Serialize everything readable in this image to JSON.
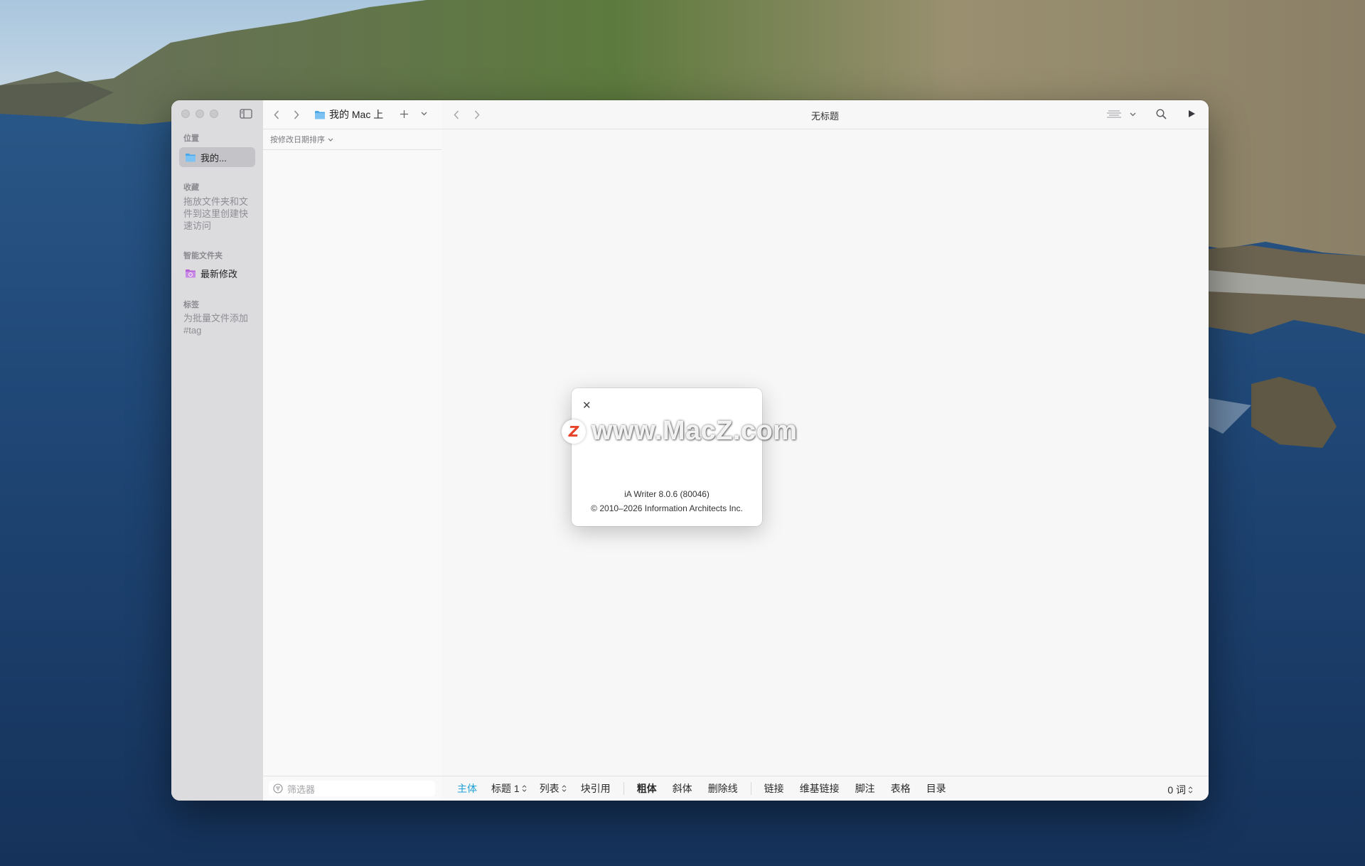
{
  "sidebar": {
    "locations_header": "位置",
    "location_item": "我的...",
    "favorites_header": "收藏",
    "favorites_hint": "拖放文件夹和文件到这里创建快速访问",
    "smart_header": "智能文件夹",
    "smart_item": "最新修改",
    "tags_header": "标签",
    "tags_hint": "为批量文件添加#tag"
  },
  "filelist": {
    "path_label": "我的 Mac 上",
    "sort_label": "按修改日期排序",
    "filter_placeholder": "筛选器"
  },
  "editor": {
    "title": "无标题"
  },
  "format_bar": {
    "body": "主体",
    "heading": "标题 1",
    "list": "列表",
    "blockquote": "块引用",
    "bold": "粗体",
    "italic": "斜体",
    "strikethrough": "删除线",
    "link": "链接",
    "wikilink": "维基链接",
    "footnote": "脚注",
    "table": "表格",
    "toc": "目录",
    "word_count": "0 词"
  },
  "about": {
    "version": "iA Writer 8.0.6 (80046)",
    "copyright": "© 2010–2026 Information Architects Inc."
  },
  "watermark": {
    "logo_letter": "Z",
    "text": "www.MacZ.com"
  },
  "colors": {
    "accent": "#1fa0d9",
    "smart_folder": "#b45fd6",
    "folder": "#4aa7e8"
  }
}
